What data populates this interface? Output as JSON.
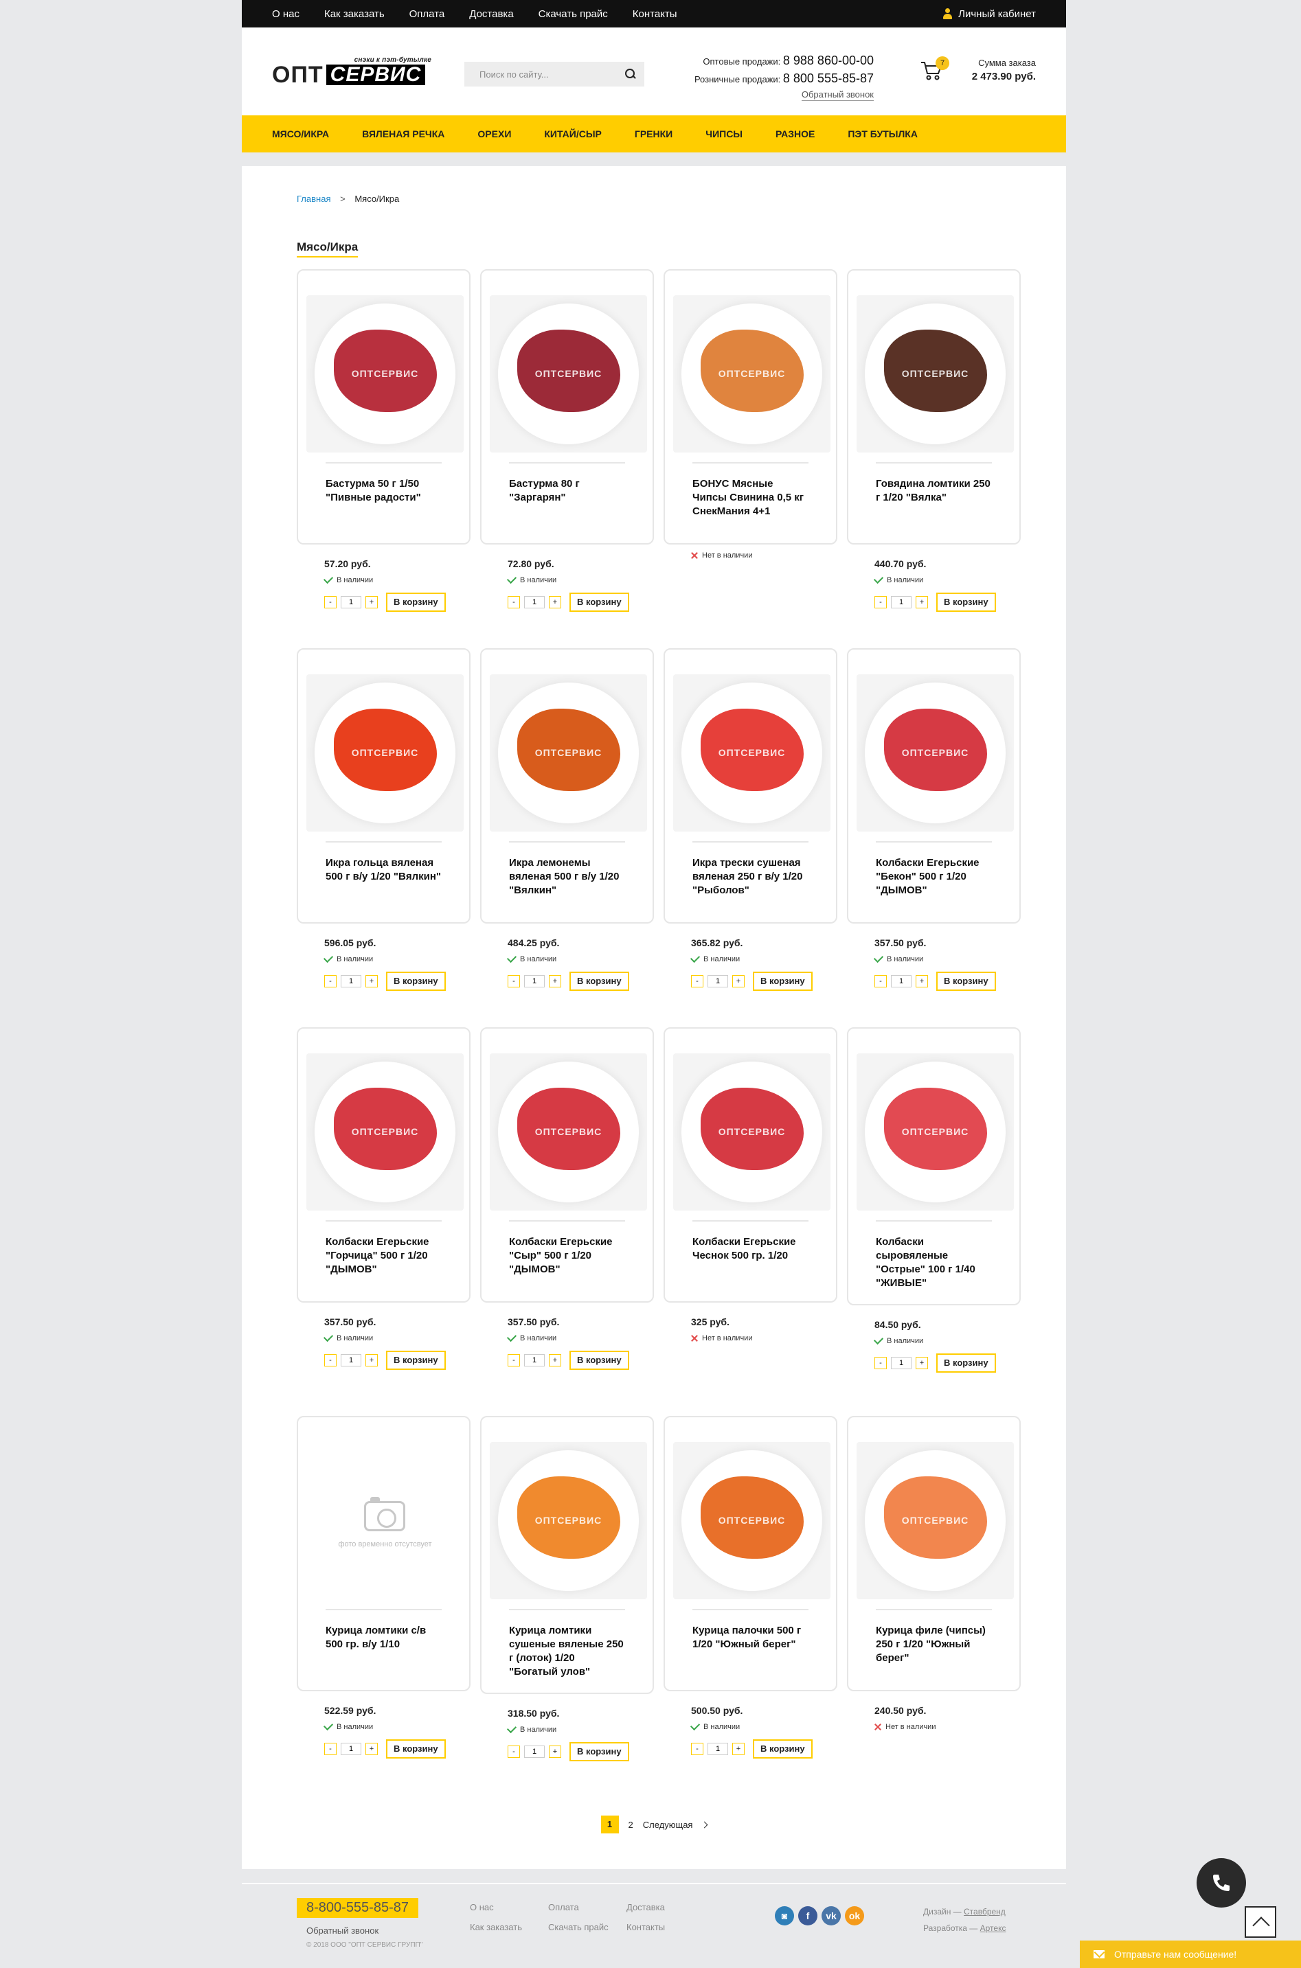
{
  "topbar": {
    "nav": [
      "О нас",
      "Как заказать",
      "Оплата",
      "Доставка",
      "Скачать прайс",
      "Контакты"
    ],
    "cabinet": "Личный кабинет"
  },
  "header": {
    "logo_tagline": "снэки к пэт-бутылке",
    "logo_left": "ОПТ",
    "logo_right": "СЕРВИС",
    "search_placeholder": "Поиск по сайту...",
    "wholesale_label": "Оптовые продажи:",
    "wholesale_phone": "8 988 860-00-00",
    "retail_label": "Розничные продажи:",
    "retail_phone": "8 800 555-85-87",
    "callback": "Обратный звонок",
    "cart_count": "7",
    "sum_label": "Сумма заказа",
    "sum_value": "2 473.90 руб."
  },
  "menu": [
    "Мясо/икра",
    "Вяленая речка",
    "Орехи",
    "Китай/сыр",
    "Гренки",
    "Чипсы",
    "Разное",
    "Пэт бутылка"
  ],
  "breadcrumb": {
    "home": "Главная",
    "separator": ">",
    "current": "Мясо/Икра"
  },
  "page_title": "Мясо/Икра",
  "labels": {
    "in_stock": "В наличии",
    "out_of_stock": "Нет в наличии",
    "to_cart": "В корзину",
    "minus": "-",
    "plus": "+",
    "qty": "1",
    "watermark": "ОПТСЕРВИС",
    "no_photo": "фото временно отсутсвует"
  },
  "colors": {
    "accent": "#ffcd00",
    "in_stock": "#3aa64a",
    "out_of_stock": "#e24b4b",
    "link": "#1e88c8"
  },
  "products": [
    {
      "name": "Бастурма 50 г 1/50 \"Пивные радости\"",
      "price": "57.20 руб.",
      "in_stock": true,
      "color": "#b8303e",
      "photo": true
    },
    {
      "name": "Бастурма 80 г \"Заргарян\"",
      "price": "72.80 руб.",
      "in_stock": true,
      "color": "#9c2a38",
      "photo": true
    },
    {
      "name": "БОНУС Мясные Чипсы Свинина 0,5 кг СнекМания 4+1",
      "price": "",
      "in_stock": false,
      "color": "#e0843e",
      "photo": true
    },
    {
      "name": "Говядина ломтики 250 г 1/20 \"Вялка\"",
      "price": "440.70 руб.",
      "in_stock": true,
      "color": "#5a3226",
      "photo": true
    },
    {
      "name": "Икра гольца вяленая 500 г в/у 1/20 \"Вялкин\"",
      "price": "596.05 руб.",
      "in_stock": true,
      "color": "#e8401e",
      "photo": true
    },
    {
      "name": "Икра лемонемы вяленая 500 г в/у 1/20 \"Вялкин\"",
      "price": "484.25 руб.",
      "in_stock": true,
      "color": "#d85c1c",
      "photo": true
    },
    {
      "name": "Икра трески сушеная вяленая 250 г в/у 1/20 \"Рыболов\"",
      "price": "365.82 руб.",
      "in_stock": true,
      "color": "#e6403a",
      "photo": true
    },
    {
      "name": "Колбаски Егерьские \"Бекон\" 500 г 1/20 \"ДЫМОВ\"",
      "price": "357.50 руб.",
      "in_stock": true,
      "color": "#d63a44",
      "photo": true
    },
    {
      "name": "Колбаски Егерьские \"Горчица\" 500 г 1/20 \"ДЫМОВ\"",
      "price": "357.50 руб.",
      "in_stock": true,
      "color": "#d63a44",
      "photo": true
    },
    {
      "name": "Колбаски Егерьские \"Сыр\" 500 г 1/20 \"ДЫМОВ\"",
      "price": "357.50 руб.",
      "in_stock": true,
      "color": "#d63a44",
      "photo": true
    },
    {
      "name": "Колбаски Егерьские Чеснок 500 гр. 1/20",
      "price": "325 руб.",
      "in_stock": false,
      "color": "#d63a44",
      "photo": true
    },
    {
      "name": "Колбаски сыровяленые \"Острые\" 100 г 1/40 \"ЖИВЫЕ\"",
      "price": "84.50 руб.",
      "in_stock": true,
      "color": "#e24a52",
      "photo": true
    },
    {
      "name": "Курица ломтики с/в 500 гр. в/у 1/10",
      "price": "522.59 руб.",
      "in_stock": true,
      "color": "",
      "photo": false
    },
    {
      "name": "Курица ломтики сушеные вяленые 250 г (лоток) 1/20 \"Богатый улов\"",
      "price": "318.50 руб.",
      "in_stock": true,
      "color": "#f08a2e",
      "photo": true
    },
    {
      "name": "Курица палочки 500 г 1/20 \"Южный берег\"",
      "price": "500.50 руб.",
      "in_stock": true,
      "color": "#e8702a",
      "photo": true
    },
    {
      "name": "Курица филе (чипсы) 250 г 1/20 \"Южный берег\"",
      "price": "240.50 руб.",
      "in_stock": false,
      "color": "#f2864e",
      "photo": true
    }
  ],
  "pager": {
    "current": "1",
    "pages": [
      "2"
    ],
    "next": "Следующая"
  },
  "footer": {
    "phone": "8-800-555-85-87",
    "callback": "Обратный звонок",
    "copyright": "© 2018 ООО \"ОПТ СЕРВИС ГРУПП\"",
    "nav": [
      "О нас",
      "Оплата",
      "Доставка",
      "Как заказать",
      "Скачать прайс",
      "Контакты"
    ],
    "social": [
      {
        "icon": "instagram-icon",
        "glyph": "◙",
        "color": "#2f7fb8"
      },
      {
        "icon": "facebook-icon",
        "glyph": "f",
        "color": "#3b5b98"
      },
      {
        "icon": "vk-icon",
        "glyph": "vk",
        "color": "#4a76a8"
      },
      {
        "icon": "odnoklassniki-icon",
        "glyph": "ok",
        "color": "#f49a1a"
      }
    ],
    "design_label": "Дизайн —",
    "design_link": "Ставбренд",
    "dev_label": "Разработка —",
    "dev_link": "Артекс"
  },
  "chat": {
    "message": "Отправьте нам сообщение!"
  }
}
